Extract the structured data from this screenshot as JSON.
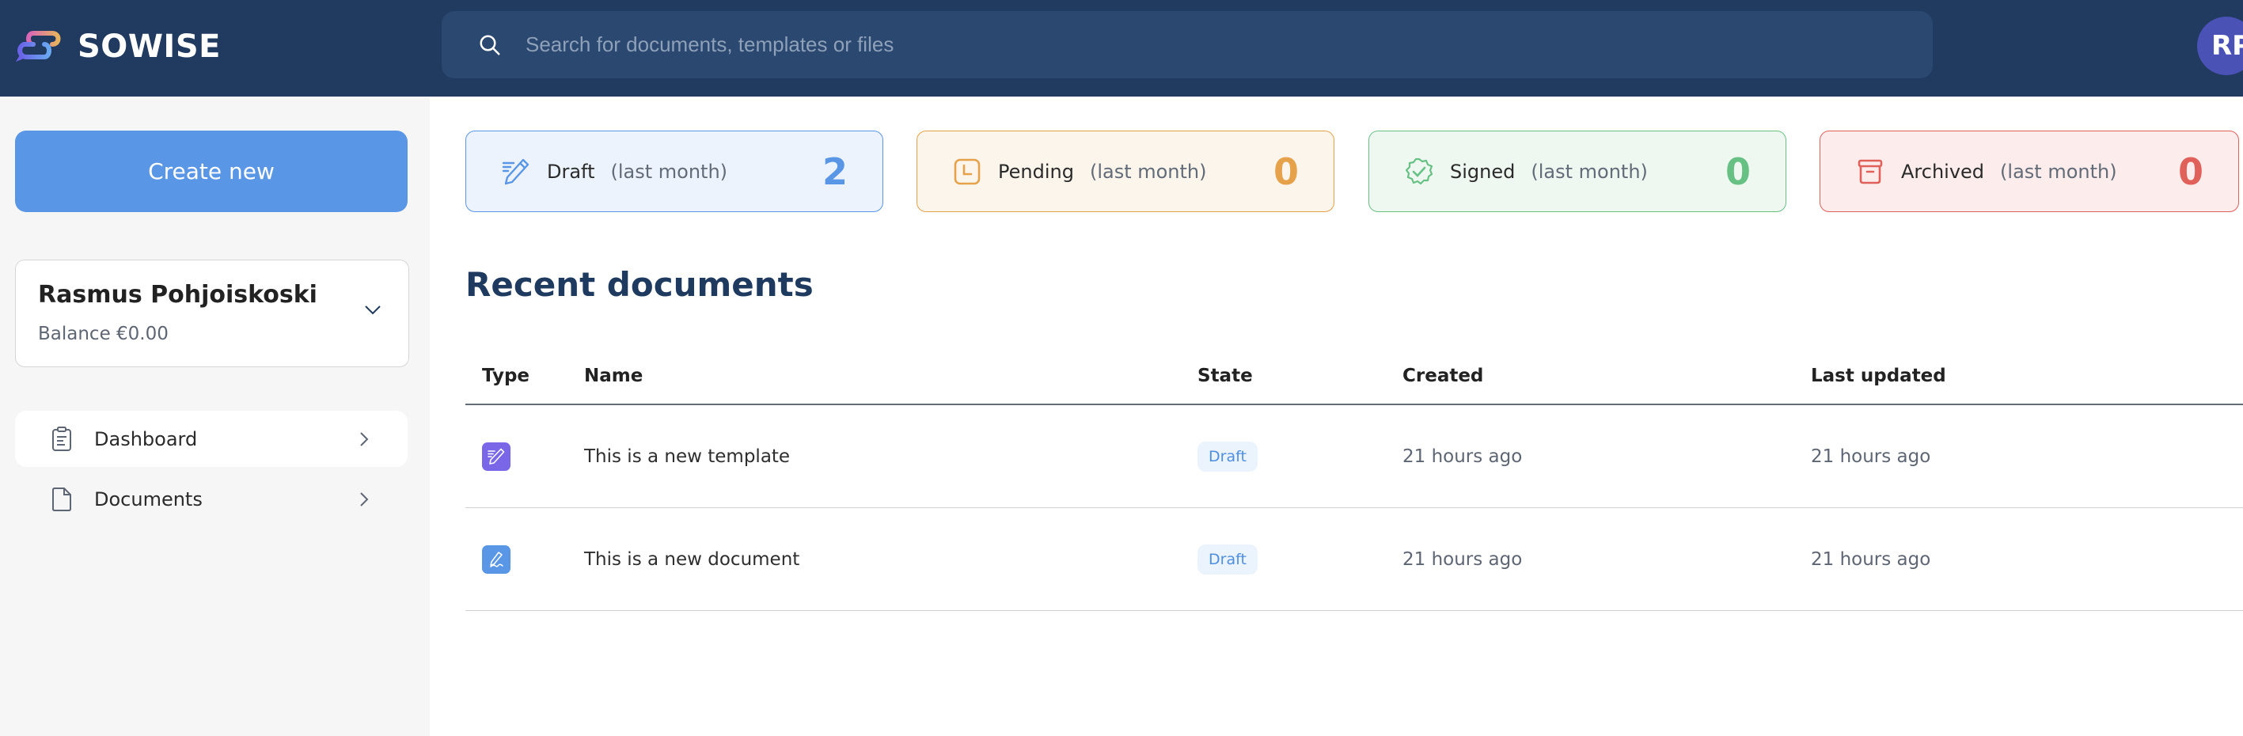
{
  "header": {
    "brand": "SOWISE",
    "search": {
      "placeholder": "Search for documents, templates or files",
      "value": ""
    },
    "avatar_initials": "RP",
    "colors": {
      "background": "#213a5f",
      "search_bg": "#2a4870",
      "avatar": "#4a52b5"
    }
  },
  "sidebar": {
    "create_button": "Create new",
    "user": {
      "name": "Rasmus Pohjoiskoski",
      "balance": "Balance €0.00"
    },
    "nav": [
      {
        "label": "Dashboard",
        "icon": "clipboard-icon",
        "active": true
      },
      {
        "label": "Documents",
        "icon": "file-icon",
        "active": false
      }
    ]
  },
  "stats": [
    {
      "label": "Draft",
      "period": "(last month)",
      "value": "2",
      "icon": "pencil-lines-icon",
      "color": "#5a96e6"
    },
    {
      "label": "Pending",
      "period": "(last month)",
      "value": "0",
      "icon": "clock-square-icon",
      "color": "#e6a24b"
    },
    {
      "label": "Signed",
      "period": "(last month)",
      "value": "0",
      "icon": "badge-check-icon",
      "color": "#68c184"
    },
    {
      "label": "Archived",
      "period": "(last month)",
      "value": "0",
      "icon": "archive-icon",
      "color": "#e0605a"
    }
  ],
  "recent": {
    "title": "Recent documents",
    "columns": [
      "Type",
      "Name",
      "State",
      "Created",
      "Last updated"
    ],
    "rows": [
      {
        "type": "template",
        "type_icon": "pencil-lines-icon",
        "type_color": "#7a67e8",
        "name": "This is a new template",
        "state": "Draft",
        "created": "21 hours ago",
        "updated": "21 hours ago"
      },
      {
        "type": "document",
        "type_icon": "signature-icon",
        "type_color": "#5a96e6",
        "name": "This is a new document",
        "state": "Draft",
        "created": "21 hours ago",
        "updated": "21 hours ago"
      }
    ]
  }
}
